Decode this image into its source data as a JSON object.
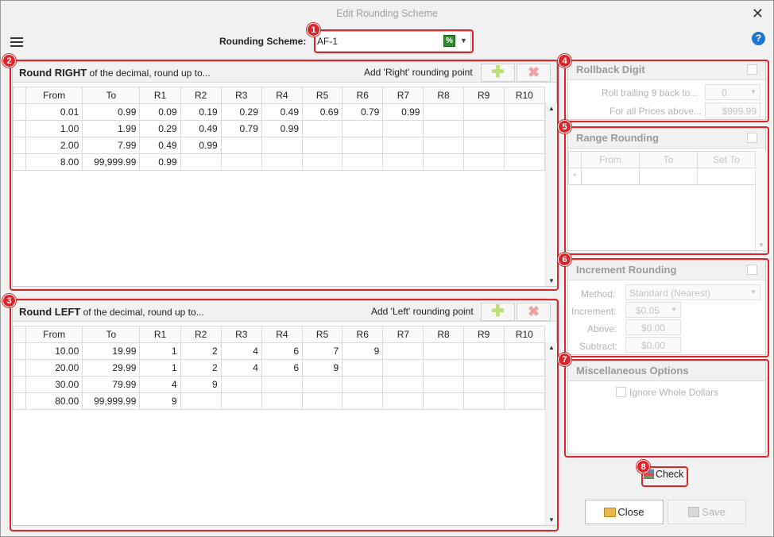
{
  "window": {
    "title": "Edit Rounding Scheme",
    "close_glyph": "✕",
    "help_glyph": "?"
  },
  "scheme": {
    "label": "Rounding Scheme:",
    "value": "AF-1",
    "pct_glyph": "%"
  },
  "badges": [
    "1",
    "2",
    "3",
    "4",
    "5",
    "6",
    "7",
    "8"
  ],
  "right_panel": {
    "title": "Round RIGHT",
    "subtitle": " of the decimal, round up to...",
    "add_label": "Add 'Right' rounding point",
    "headers": [
      "From",
      "To",
      "R1",
      "R2",
      "R3",
      "R4",
      "R5",
      "R6",
      "R7",
      "R8",
      "R9",
      "R10"
    ],
    "rows": [
      [
        "0.01",
        "0.99",
        "0.09",
        "0.19",
        "0.29",
        "0.49",
        "0.69",
        "0.79",
        "0.99",
        "",
        "",
        ""
      ],
      [
        "1.00",
        "1.99",
        "0.29",
        "0.49",
        "0.79",
        "0.99",
        "",
        "",
        "",
        "",
        "",
        ""
      ],
      [
        "2.00",
        "7.99",
        "0.49",
        "0.99",
        "",
        "",
        "",
        "",
        "",
        "",
        "",
        ""
      ],
      [
        "8.00",
        "99,999.99",
        "0.99",
        "",
        "",
        "",
        "",
        "",
        "",
        "",
        "",
        ""
      ]
    ]
  },
  "left_panel": {
    "title": "Round LEFT",
    "subtitle": " of the decimal, round up to...",
    "add_label": "Add 'Left' rounding point",
    "headers": [
      "From",
      "To",
      "R1",
      "R2",
      "R3",
      "R4",
      "R5",
      "R6",
      "R7",
      "R8",
      "R9",
      "R10"
    ],
    "rows": [
      [
        "10.00",
        "19.99",
        "1",
        "2",
        "4",
        "6",
        "7",
        "9",
        "",
        "",
        "",
        ""
      ],
      [
        "20.00",
        "29.99",
        "1",
        "2",
        "4",
        "6",
        "9",
        "",
        "",
        "",
        "",
        ""
      ],
      [
        "30.00",
        "79.99",
        "4",
        "9",
        "",
        "",
        "",
        "",
        "",
        "",
        "",
        ""
      ],
      [
        "80.00",
        "99,999.99",
        "9",
        "",
        "",
        "",
        "",
        "",
        "",
        "",
        "",
        ""
      ]
    ]
  },
  "rollback": {
    "title": "Rollback Digit",
    "roll_label": "Roll trailing 9 back to...",
    "roll_value": "0",
    "above_label": "For all Prices above...",
    "above_value": "$999.99"
  },
  "range": {
    "title": "Range Rounding",
    "headers": [
      "From",
      "To",
      "Set To"
    ],
    "row_marker": "*"
  },
  "increment": {
    "title": "Increment Rounding",
    "method_label": "Method:",
    "method_value": "Standard (Nearest)",
    "increment_label": "Increment:",
    "increment_value": "$0.05",
    "above_label": "Above:",
    "above_value": "$0.00",
    "subtract_label": "Subtract:",
    "subtract_value": "$0.00"
  },
  "misc": {
    "title": "Miscellaneous Options",
    "ignore_label": "Ignore Whole Dollars"
  },
  "buttons": {
    "check": "Check",
    "close": "Close",
    "save": "Save"
  },
  "colors": {
    "highlight": "#d9262a",
    "help": "#1e74d0",
    "pct": "#2e8b2e"
  }
}
